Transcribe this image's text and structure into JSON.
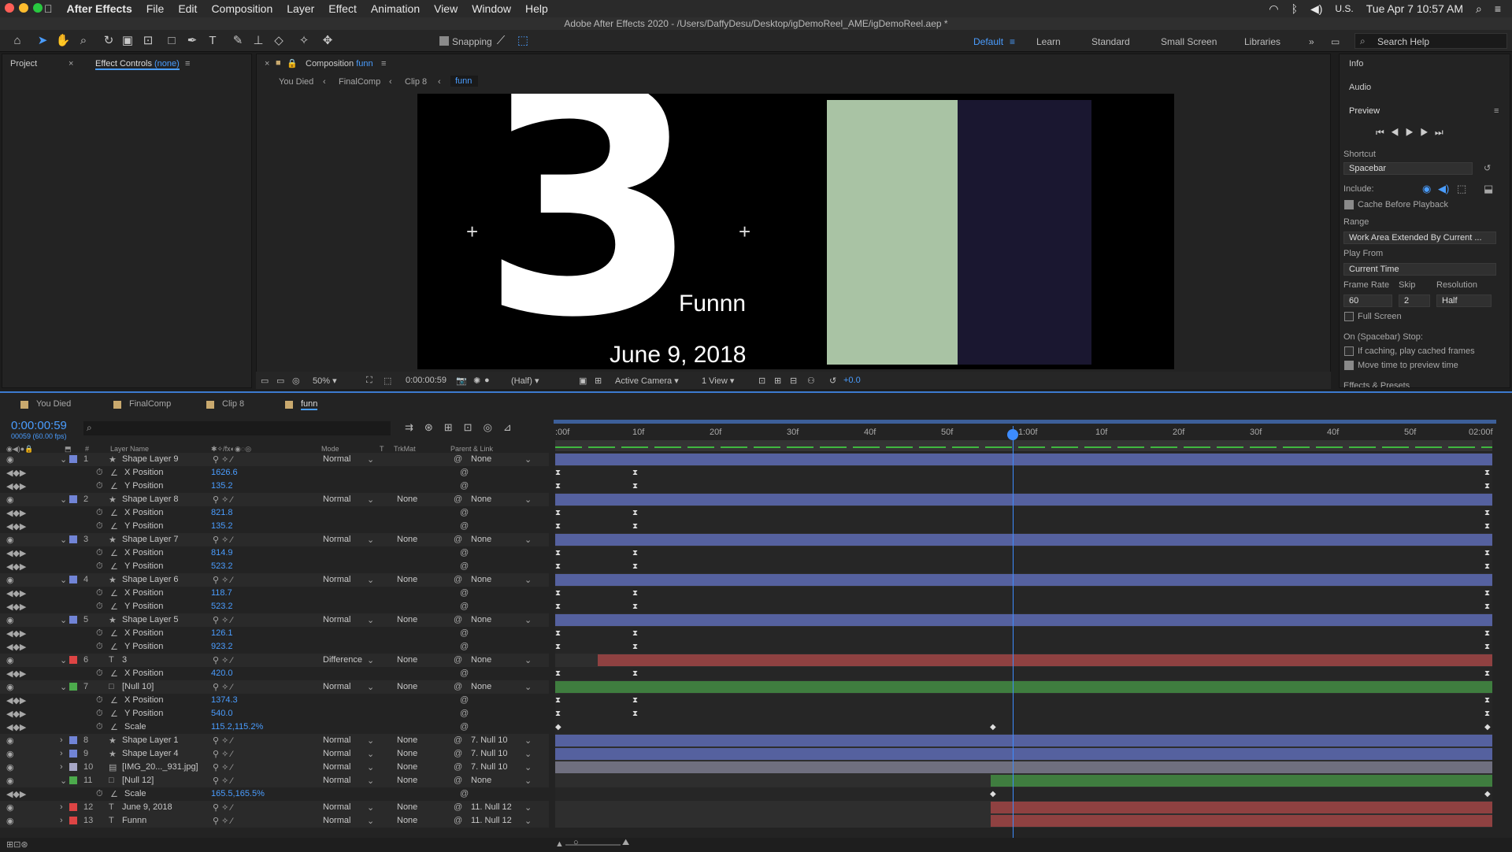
{
  "menubar": {
    "apple": "",
    "app": "After Effects",
    "items": [
      "File",
      "Edit",
      "Composition",
      "Layer",
      "Effect",
      "Animation",
      "View",
      "Window",
      "Help"
    ],
    "locale": "U.S.",
    "clock": "Tue Apr 7  10:57 AM"
  },
  "titlebar": {
    "title": "Adobe After Effects 2020 - /Users/DaffyDesu/Desktop/igDemoReel_AME/igDemoReel.aep *"
  },
  "toolbar": {
    "snapping": "Snapping",
    "workspaces": [
      "Default",
      "Learn",
      "Standard",
      "Small Screen",
      "Libraries"
    ],
    "search_placeholder": "Search Help"
  },
  "project_panel": {
    "tab_project": "Project",
    "tab_effect_controls": "Effect Controls",
    "effect_target": "(none)"
  },
  "comp_panel": {
    "tab_label": "Composition",
    "comp_name": "funn",
    "breadcrumbs": [
      "You Died",
      "FinalComp",
      "Clip 8",
      "funn"
    ]
  },
  "viewer": {
    "big_number": "3",
    "text_funnn": "Funnn",
    "text_date": "June 9, 2018"
  },
  "comp_footer": {
    "zoom": "50%",
    "timecode": "0:00:00:59",
    "resolution": "(Half)",
    "camera": "Active Camera",
    "views": "1 View",
    "exposure": "+0.0"
  },
  "right_panel": {
    "info": "Info",
    "audio": "Audio",
    "preview": "Preview",
    "shortcut_label": "Shortcut",
    "shortcut_value": "Spacebar",
    "include_label": "Include:",
    "cache_label": "Cache Before Playback",
    "range_label": "Range",
    "range_value": "Work Area Extended By Current ...",
    "play_from_label": "Play From",
    "play_from_value": "Current Time",
    "frame_rate_label": "Frame Rate",
    "skip_label": "Skip",
    "resolution_label": "Resolution",
    "frame_rate_value": "60",
    "skip_value": "2",
    "resolution_value": "Half",
    "full_screen": "Full Screen",
    "on_stop": "On (Spacebar) Stop:",
    "if_caching": "If caching, play cached frames",
    "move_time": "Move time to preview time",
    "effects_presets": "Effects & Presets"
  },
  "timeline": {
    "tabs": [
      "You Died",
      "FinalComp",
      "Clip 8",
      "funn"
    ],
    "timecode": "0:00:00:59",
    "fps": "00059 (60.00 fps)",
    "col_layer_name": "Layer Name",
    "col_mode": "Mode",
    "col_t": "T",
    "col_trkmat": "TrkMat",
    "col_parent": "Parent & Link",
    "ruler": [
      ":00f",
      "10f",
      "20f",
      "30f",
      "40f",
      "50f",
      "1:00f",
      "10f",
      "20f",
      "30f",
      "40f",
      "50f",
      "02:00f"
    ],
    "rows": [
      {
        "num": "1",
        "name": "Shape Layer 9",
        "mode": "Normal",
        "trk": "",
        "parent": "None",
        "color": "#7184d6",
        "type": "layer",
        "icon": "star",
        "bar": "#55619f",
        "start": 0
      },
      {
        "prop": "X Position",
        "value": "1626.6",
        "kf": true
      },
      {
        "prop": "Y Position",
        "value": "135.2",
        "kf": true
      },
      {
        "num": "2",
        "name": "Shape Layer 8",
        "mode": "Normal",
        "trk": "None",
        "parent": "None",
        "color": "#7184d6",
        "type": "layer",
        "icon": "star",
        "bar": "#55619f",
        "start": 0
      },
      {
        "prop": "X Position",
        "value": "821.8",
        "kf": true
      },
      {
        "prop": "Y Position",
        "value": "135.2",
        "kf": true
      },
      {
        "num": "3",
        "name": "Shape Layer 7",
        "mode": "Normal",
        "trk": "None",
        "parent": "None",
        "color": "#7184d6",
        "type": "layer",
        "icon": "star",
        "bar": "#55619f",
        "start": 0
      },
      {
        "prop": "X Position",
        "value": "814.9",
        "kf": true
      },
      {
        "prop": "Y Position",
        "value": "523.2",
        "kf": true
      },
      {
        "num": "4",
        "name": "Shape Layer 6",
        "mode": "Normal",
        "trk": "None",
        "parent": "None",
        "color": "#7184d6",
        "type": "layer",
        "icon": "star",
        "bar": "#55619f",
        "start": 0
      },
      {
        "prop": "X Position",
        "value": "118.7",
        "kf": true
      },
      {
        "prop": "Y Position",
        "value": "523.2",
        "kf": true
      },
      {
        "num": "5",
        "name": "Shape Layer 5",
        "mode": "Normal",
        "trk": "None",
        "parent": "None",
        "color": "#7184d6",
        "type": "layer",
        "icon": "star",
        "bar": "#55619f",
        "start": 0
      },
      {
        "prop": "X Position",
        "value": "126.1",
        "kf": true
      },
      {
        "prop": "Y Position",
        "value": "923.2",
        "kf": true
      },
      {
        "num": "6",
        "name": "3",
        "mode": "Difference",
        "trk": "None",
        "parent": "None",
        "color": "#d44",
        "type": "layer",
        "icon": "T",
        "bar": "#8f4141",
        "start": 0.045
      },
      {
        "prop": "X Position",
        "value": "420.0",
        "kf": true
      },
      {
        "num": "7",
        "name": "[Null 10]",
        "mode": "Normal",
        "trk": "None",
        "parent": "None",
        "color": "#4caa4c",
        "type": "layer",
        "icon": "sq",
        "bar": "#3f7d3f",
        "start": 0
      },
      {
        "prop": "X Position",
        "value": "1374.3",
        "kf": true
      },
      {
        "prop": "Y Position",
        "value": "540.0",
        "kf": true
      },
      {
        "prop": "Scale",
        "value": "115.2,115.2%",
        "kf": false,
        "diamond": true
      },
      {
        "num": "8",
        "name": "Shape Layer 1",
        "mode": "Normal",
        "trk": "None",
        "parent": "7. Null 10",
        "color": "#7184d6",
        "type": "layer",
        "icon": "star",
        "bar": "#55619f",
        "start": 0
      },
      {
        "num": "9",
        "name": "Shape Layer 4",
        "mode": "Normal",
        "trk": "None",
        "parent": "7. Null 10",
        "color": "#7184d6",
        "type": "layer",
        "icon": "star",
        "bar": "#55619f",
        "start": 0
      },
      {
        "num": "10",
        "name": "[IMG_20..._931.jpg]",
        "mode": "Normal",
        "trk": "None",
        "parent": "7. Null 10",
        "color": "#a7a7c7",
        "type": "layer",
        "icon": "img",
        "bar": "#6f6f7f",
        "start": 0
      },
      {
        "num": "11",
        "name": "[Null 12]",
        "mode": "Normal",
        "trk": "None",
        "parent": "None",
        "color": "#4caa4c",
        "type": "layer",
        "icon": "sq",
        "bar": "#3f7d3f",
        "start": 0.465
      },
      {
        "prop": "Scale",
        "value": "165.5,165.5%",
        "kf": false,
        "diamond2": true
      },
      {
        "num": "12",
        "name": "June 9, 2018",
        "mode": "Normal",
        "trk": "None",
        "parent": "11. Null 12",
        "color": "#d44",
        "type": "layer",
        "icon": "T",
        "bar": "#8f4141",
        "start": 0.465
      },
      {
        "num": "13",
        "name": "Funnn",
        "mode": "Normal",
        "trk": "None",
        "parent": "11. Null 12",
        "color": "#d44",
        "type": "layer",
        "icon": "T",
        "bar": "#8f4141",
        "start": 0.465
      }
    ]
  }
}
